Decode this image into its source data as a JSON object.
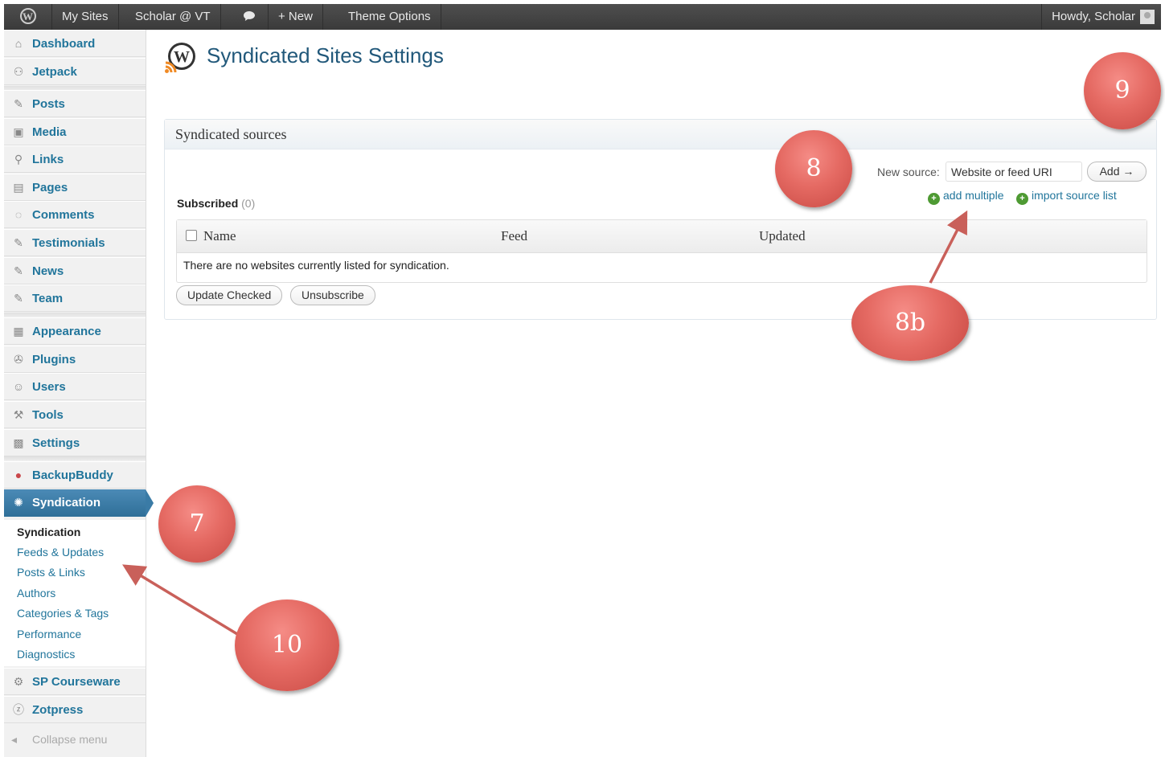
{
  "adminbar": {
    "items": [
      "My Sites",
      "Scholar @ VT",
      "+ New",
      "Theme Options"
    ],
    "howdy": "Howdy, Scholar"
  },
  "sidebar": {
    "items": [
      {
        "label": "Dashboard",
        "icon": "dashboard-icon"
      },
      {
        "label": "Jetpack",
        "icon": "jetpack-icon"
      },
      {
        "label": "Posts",
        "icon": "pin-icon"
      },
      {
        "label": "Media",
        "icon": "media-icon"
      },
      {
        "label": "Links",
        "icon": "link-icon"
      },
      {
        "label": "Pages",
        "icon": "pages-icon"
      },
      {
        "label": "Comments",
        "icon": "comment-icon"
      },
      {
        "label": "Testimonials",
        "icon": "pin-icon"
      },
      {
        "label": "News",
        "icon": "pin-icon"
      },
      {
        "label": "Team",
        "icon": "pin-icon"
      },
      {
        "label": "Appearance",
        "icon": "appearance-icon"
      },
      {
        "label": "Plugins",
        "icon": "plugin-icon"
      },
      {
        "label": "Users",
        "icon": "users-icon"
      },
      {
        "label": "Tools",
        "icon": "tools-icon"
      },
      {
        "label": "Settings",
        "icon": "settings-icon"
      },
      {
        "label": "BackupBuddy",
        "icon": "backupbuddy-icon"
      },
      {
        "label": "Syndication",
        "icon": "syndication-icon"
      },
      {
        "label": "SP Courseware",
        "icon": "courseware-icon"
      },
      {
        "label": "Zotpress",
        "icon": "zotpress-icon"
      }
    ],
    "submenu": [
      "Syndication",
      "Feeds & Updates",
      "Posts & Links",
      "Authors",
      "Categories & Tags",
      "Performance",
      "Diagnostics"
    ],
    "collapse": "Collapse menu"
  },
  "main": {
    "title": "Syndicated Sites Settings",
    "box_title": "Syndicated sources",
    "new_source_label": "New source:",
    "new_source_placeholder": "Website or feed URI",
    "add_button": "Add →",
    "add_multiple": "add multiple",
    "import_list": "import source list",
    "subscribed_label": "Subscribed",
    "subscribed_count": "(0)",
    "columns": [
      "Name",
      "Feed",
      "Updated"
    ],
    "empty_message": "There are no websites currently listed for syndication.",
    "update_checked": "Update Checked",
    "unsubscribe": "Unsubscribe"
  },
  "annotations": [
    "7",
    "8",
    "8b",
    "9",
    "10"
  ],
  "colors": {
    "accent": "#21759b",
    "marker": "#e56a63",
    "arrow": "#c9605a",
    "active_menu": "#3a7ba6"
  }
}
